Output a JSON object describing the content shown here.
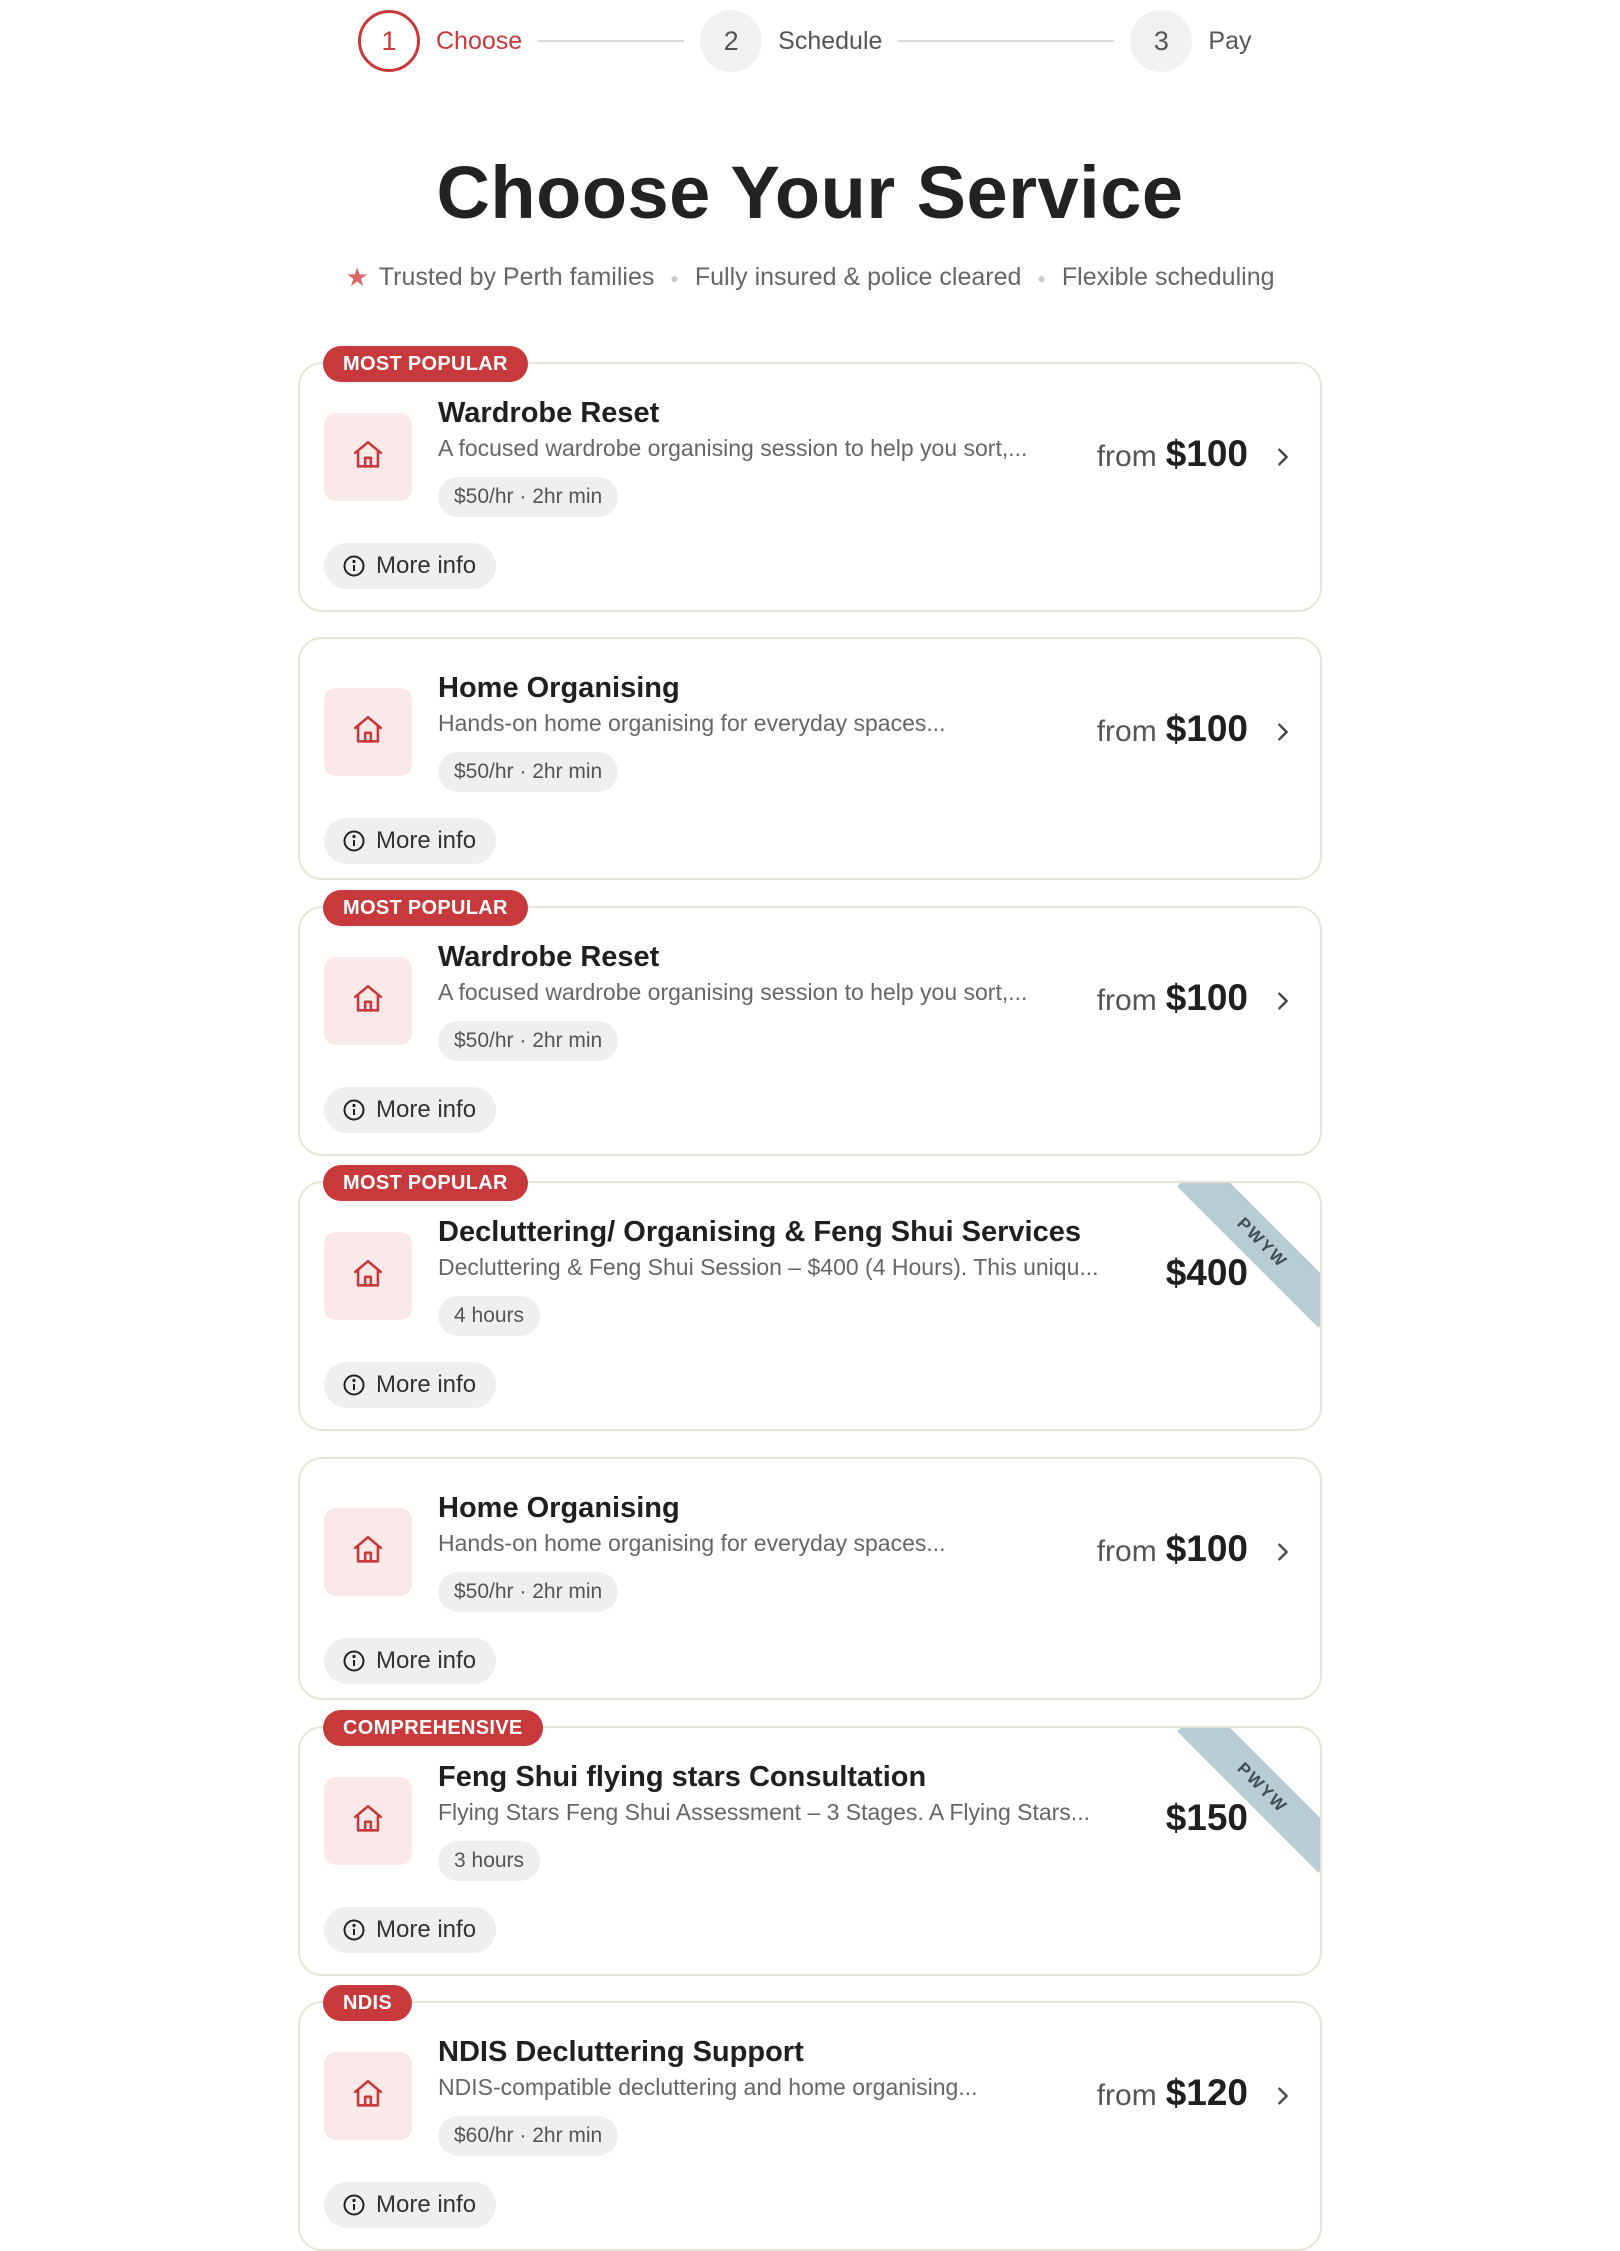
{
  "steps": [
    {
      "number": "1",
      "label": "Choose"
    },
    {
      "number": "2",
      "label": "Schedule"
    },
    {
      "number": "3",
      "label": "Pay"
    }
  ],
  "title": "Choose Your Service",
  "trust": [
    "Trusted by Perth families",
    "Fully insured & police cleared",
    "Flexible scheduling"
  ],
  "colors": {
    "accent": "#c8393b",
    "icon_bg": "#fbe9e9",
    "ribbon": "#b7cdd3"
  },
  "more_info_label": "More info",
  "from_label": "from",
  "services": [
    {
      "badge": "MOST POPULAR",
      "name": "Wardrobe Reset",
      "description": "A focused wardrobe organising session to help you sort,...",
      "meta": "$50/hr · 2hr min",
      "price": "$100",
      "from": true,
      "ribbon": "",
      "icon": "house-icon"
    },
    {
      "badge": "",
      "name": "Home Organising",
      "description": "Hands-on home organising for everyday spaces...",
      "meta": "$50/hr · 2hr min",
      "price": "$100",
      "from": true,
      "ribbon": "",
      "icon": "house-icon"
    },
    {
      "badge": "MOST POPULAR",
      "name": "Wardrobe Reset",
      "description": "A focused wardrobe organising session to help you sort,...",
      "meta": "$50/hr · 2hr min",
      "price": "$100",
      "from": true,
      "ribbon": "",
      "icon": "house-icon"
    },
    {
      "badge": "MOST POPULAR",
      "name": "Decluttering/ Organising & Feng Shui Services",
      "description": "Decluttering & Feng Shui Session – $400 (4 Hours). This uniqu...",
      "meta": "4 hours",
      "price": "$400",
      "from": false,
      "ribbon": "PWYW",
      "icon": "house-icon"
    },
    {
      "badge": "",
      "name": "Home Organising",
      "description": "Hands-on home organising for everyday spaces...",
      "meta": "$50/hr · 2hr min",
      "price": "$100",
      "from": true,
      "ribbon": "",
      "icon": "house-icon"
    },
    {
      "badge": "COMPREHENSIVE",
      "name": "Feng Shui flying stars Consultation",
      "description": "Flying Stars Feng Shui Assessment – 3 Stages. A Flying Stars...",
      "meta": "3 hours",
      "price": "$150",
      "from": false,
      "ribbon": "PWYW",
      "icon": "house-icon"
    },
    {
      "badge": "NDIS",
      "name": "NDIS Decluttering Support",
      "description": "NDIS-compatible decluttering and home organising...",
      "meta": "$60/hr · 2hr min",
      "price": "$120",
      "from": true,
      "ribbon": "",
      "icon": "house-icon"
    }
  ]
}
